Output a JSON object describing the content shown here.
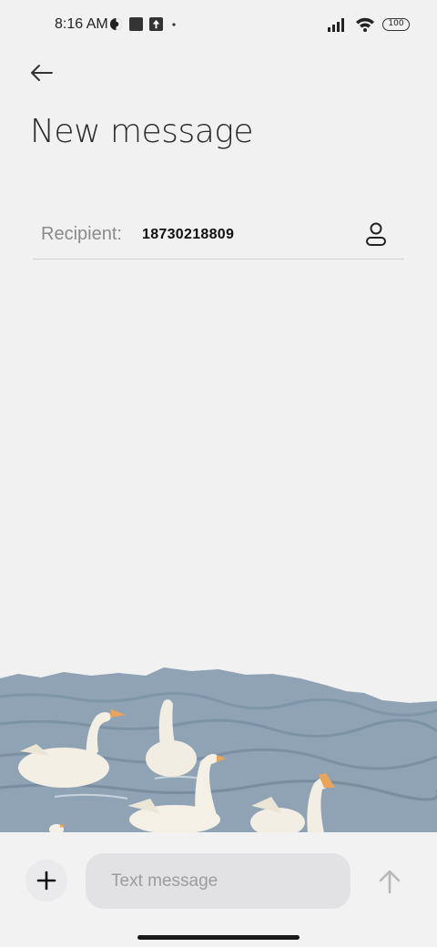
{
  "status_bar": {
    "time": "8:16 AM",
    "battery": "100",
    "icons": [
      "vpn-icon",
      "square-notification-icon",
      "upload-notification-icon",
      "dot-icon",
      "signal-icon",
      "wifi-icon",
      "battery-icon"
    ]
  },
  "header": {
    "back_icon": "arrow-left-icon",
    "title": "New message"
  },
  "recipient": {
    "label": "Recipient:",
    "value": "18730218809",
    "contact_icon": "person-icon"
  },
  "composer": {
    "add_icon": "plus-icon",
    "placeholder": "Text message",
    "send_icon": "arrow-up-icon"
  },
  "colors": {
    "background": "#f1f1f2",
    "water": "#8ea3b5",
    "input_bg": "#e2e2e4",
    "disabled_send": "#b8b8bb"
  }
}
